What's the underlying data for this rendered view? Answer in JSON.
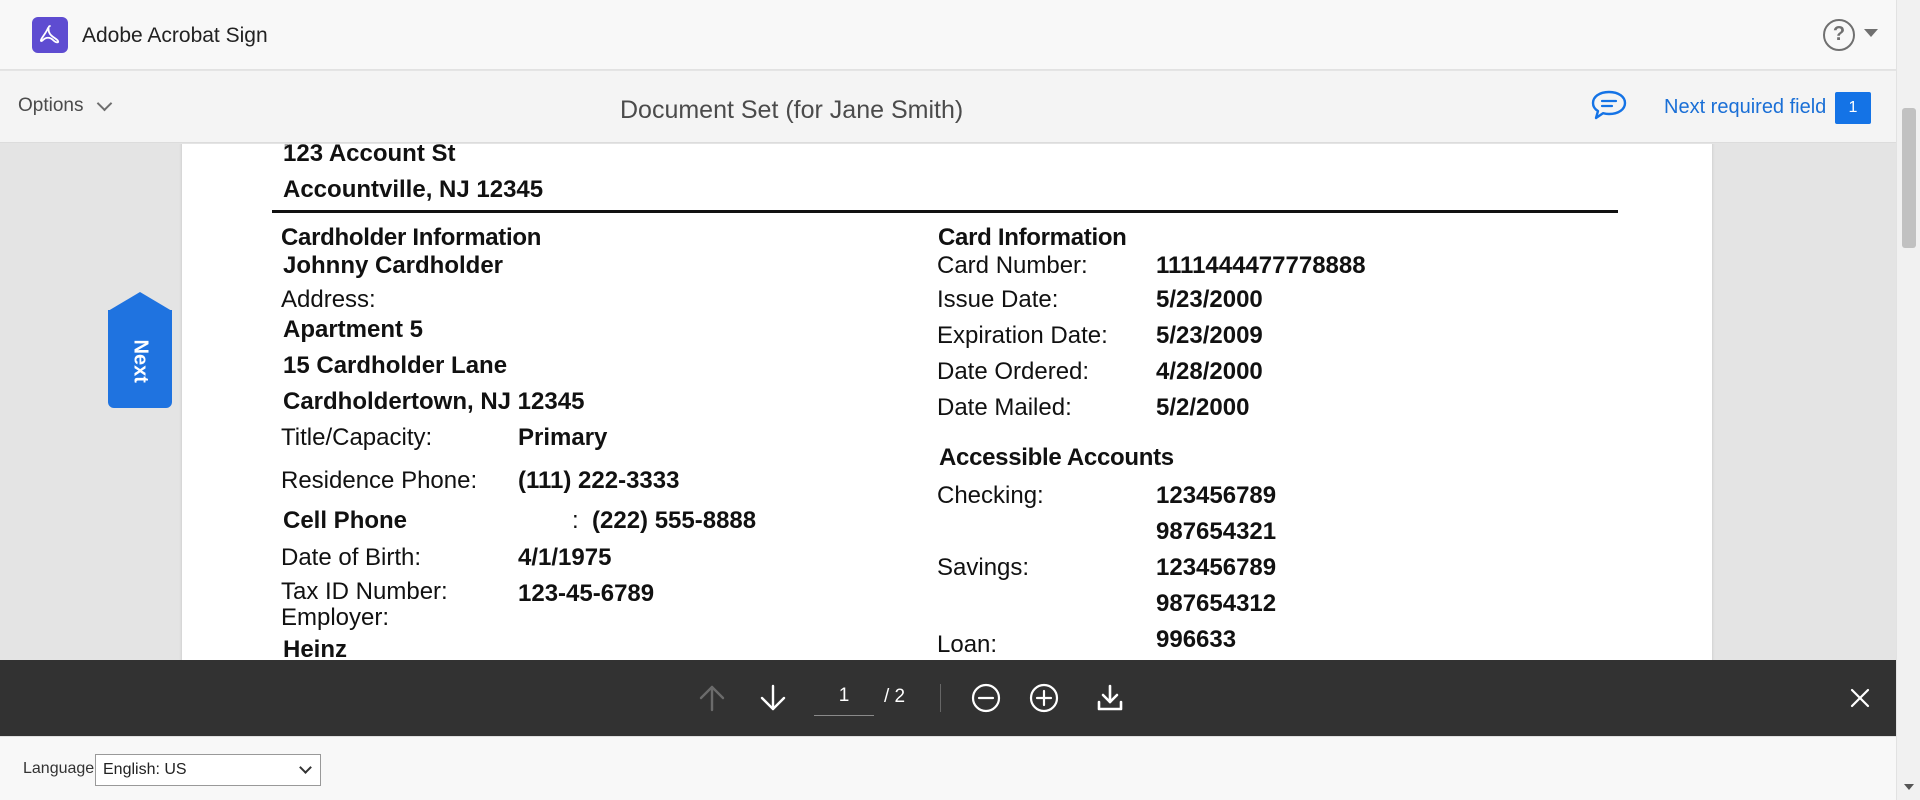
{
  "app": {
    "title": "Adobe Acrobat Sign",
    "help_icon": "question-circle"
  },
  "subheader": {
    "options_label": "Options",
    "document_title": "Document Set (for Jane Smith)",
    "next_required_label": "Next required field",
    "required_count": "1"
  },
  "next_tab": {
    "label": "Next"
  },
  "document": {
    "address_line_1": "123 Account St",
    "address_line_2": "Accountville, NJ 12345",
    "cardholder": {
      "heading": "Cardholder Information",
      "name": "Johnny Cardholder",
      "address_label": "Address:",
      "address_1": "Apartment 5",
      "address_2": "15 Cardholder Lane",
      "address_3": "Cardholdertown, NJ 12345",
      "title_label": "Title/Capacity:",
      "title_value": "Primary",
      "res_phone_label": "Residence Phone:",
      "res_phone_value": "(111) 222-3333",
      "cell_label": "Cell Phone",
      "cell_colon": ":",
      "cell_value": "(222) 555-8888",
      "dob_label": "Date of Birth:",
      "dob_value": "4/1/1975",
      "tax_label": "Tax ID Number:",
      "tax_value": "123-45-6789",
      "employer_label": "Employer:",
      "employer_value": "Heinz"
    },
    "card": {
      "heading": "Card Information",
      "number_label": "Card Number:",
      "number_value": "1111444477778888",
      "issue_label": "Issue Date:",
      "issue_value": "5/23/2000",
      "exp_label": "Expiration Date:",
      "exp_value": "5/23/2009",
      "ordered_label": "Date Ordered:",
      "ordered_value": "4/28/2000",
      "mailed_label": "Date Mailed:",
      "mailed_value": "5/2/2000"
    },
    "accounts": {
      "heading": "Accessible Accounts",
      "checking_label": "Checking:",
      "checking_1": "123456789",
      "checking_2": "987654321",
      "savings_label": "Savings:",
      "savings_1": "123456789",
      "savings_2": "987654312",
      "loan_label": "Loan:",
      "loan_1": "996633"
    }
  },
  "toolbar": {
    "current_page": "1",
    "total_pages": "/ 2"
  },
  "footer": {
    "language_label": "Language",
    "language_value": "English: US"
  },
  "colors": {
    "accent": "#1473e6",
    "logo": "#5e4cd1",
    "toolbar": "#323232"
  }
}
